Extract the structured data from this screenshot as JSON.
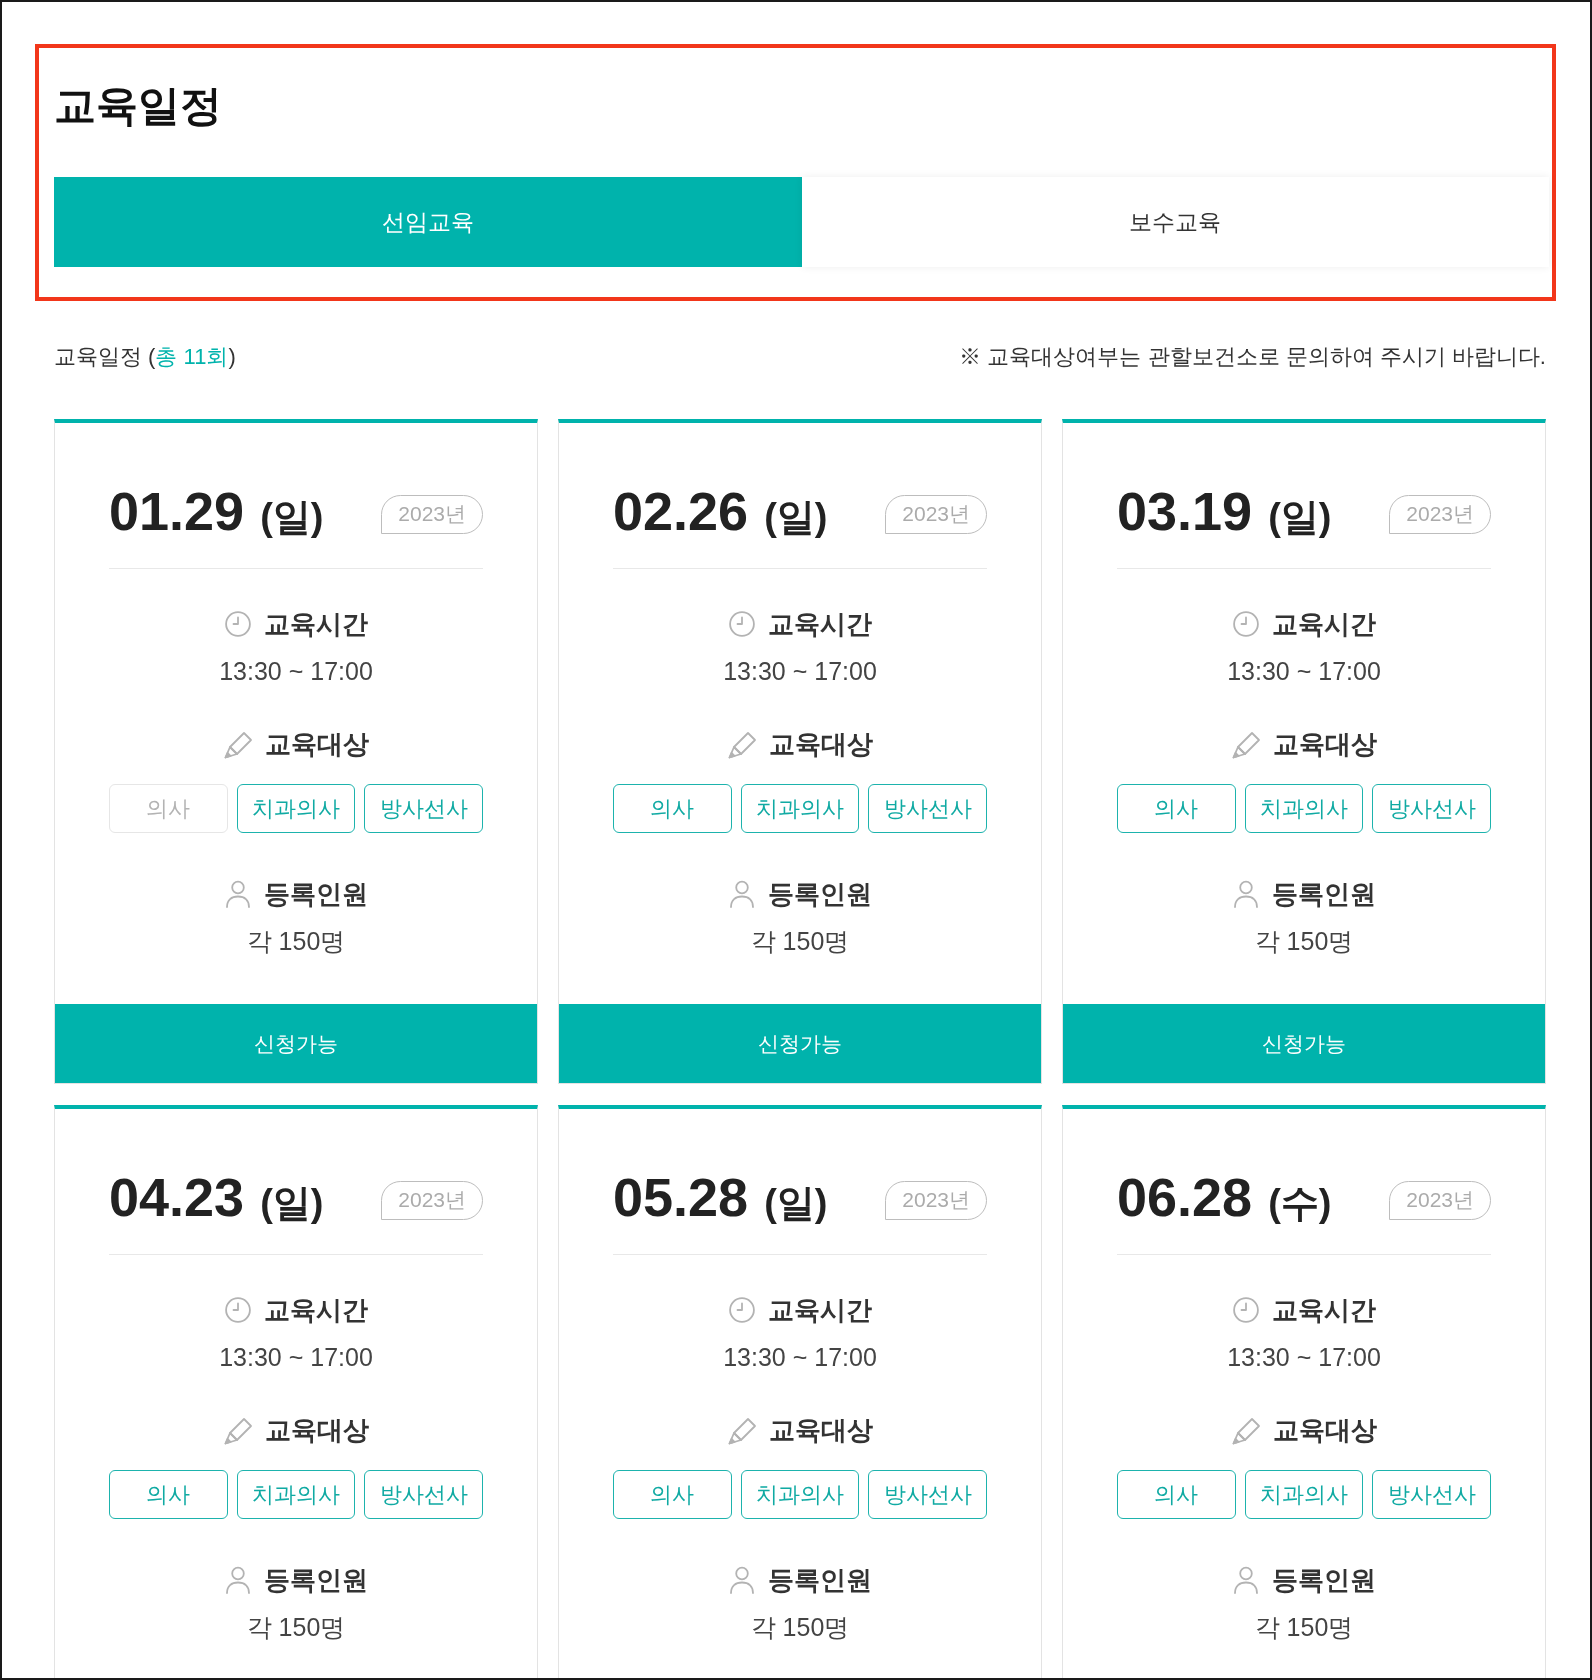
{
  "page_title": "교육일정",
  "tabs": [
    {
      "label": "선임교육",
      "selected": true
    },
    {
      "label": "보수교육",
      "selected": false
    }
  ],
  "summary": {
    "text_before": "교육일정 (",
    "count": "총 11회",
    "text_after": ")"
  },
  "notice": "※ 교육대상여부는 관할보건소로 문의하여 주시기 바랍니다.",
  "cards": [
    {
      "date": "01.29",
      "weekday": "(일)",
      "year": "2023년",
      "time_label": "교육시간",
      "time": "13:30 ~ 17:00",
      "target_label": "교육대상",
      "targets": [
        {
          "label": "의사",
          "disabled": true
        },
        {
          "label": "치과의사",
          "disabled": false
        },
        {
          "label": "방사선사",
          "disabled": false
        }
      ],
      "capacity_label": "등록인원",
      "capacity": "각 150명",
      "button": "신청가능"
    },
    {
      "date": "02.26",
      "weekday": "(일)",
      "year": "2023년",
      "time_label": "교육시간",
      "time": "13:30 ~ 17:00",
      "target_label": "교육대상",
      "targets": [
        {
          "label": "의사",
          "disabled": false
        },
        {
          "label": "치과의사",
          "disabled": false
        },
        {
          "label": "방사선사",
          "disabled": false
        }
      ],
      "capacity_label": "등록인원",
      "capacity": "각 150명",
      "button": "신청가능"
    },
    {
      "date": "03.19",
      "weekday": "(일)",
      "year": "2023년",
      "time_label": "교육시간",
      "time": "13:30 ~ 17:00",
      "target_label": "교육대상",
      "targets": [
        {
          "label": "의사",
          "disabled": false
        },
        {
          "label": "치과의사",
          "disabled": false
        },
        {
          "label": "방사선사",
          "disabled": false
        }
      ],
      "capacity_label": "등록인원",
      "capacity": "각 150명",
      "button": "신청가능"
    },
    {
      "date": "04.23",
      "weekday": "(일)",
      "year": "2023년",
      "time_label": "교육시간",
      "time": "13:30 ~ 17:00",
      "target_label": "교육대상",
      "targets": [
        {
          "label": "의사",
          "disabled": false
        },
        {
          "label": "치과의사",
          "disabled": false
        },
        {
          "label": "방사선사",
          "disabled": false
        }
      ],
      "capacity_label": "등록인원",
      "capacity": "각 150명"
    },
    {
      "date": "05.28",
      "weekday": "(일)",
      "year": "2023년",
      "time_label": "교육시간",
      "time": "13:30 ~ 17:00",
      "target_label": "교육대상",
      "targets": [
        {
          "label": "의사",
          "disabled": false
        },
        {
          "label": "치과의사",
          "disabled": false
        },
        {
          "label": "방사선사",
          "disabled": false
        }
      ],
      "capacity_label": "등록인원",
      "capacity": "각 150명"
    },
    {
      "date": "06.28",
      "weekday": "(수)",
      "year": "2023년",
      "time_label": "교육시간",
      "time": "13:30 ~ 17:00",
      "target_label": "교육대상",
      "targets": [
        {
          "label": "의사",
          "disabled": false
        },
        {
          "label": "치과의사",
          "disabled": false
        },
        {
          "label": "방사선사",
          "disabled": false
        }
      ],
      "capacity_label": "등록인원",
      "capacity": "각 150명"
    }
  ]
}
